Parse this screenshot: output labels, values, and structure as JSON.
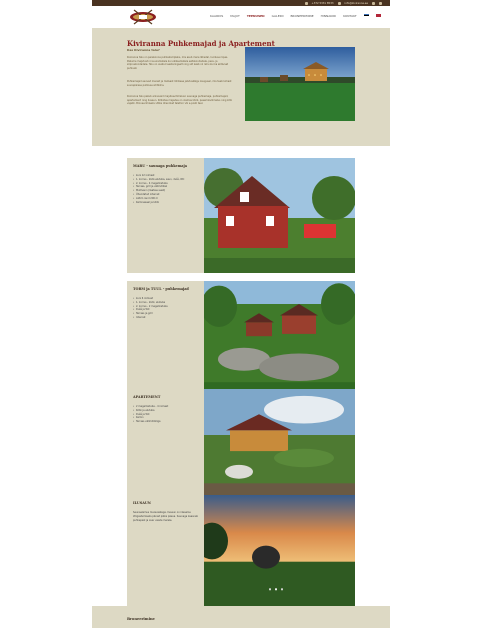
{
  "topbar": {
    "phone": "+372 5331 8533",
    "email": "info@kiviranna.ee"
  },
  "nav": {
    "items": [
      "KAARDIS",
      "MAJUT",
      "TEENUSED",
      "GALERII",
      "BRONEERIMINE",
      "HINNAKIRI",
      "KONTAKT"
    ],
    "active_index": 2
  },
  "hero": {
    "title": "Kiviranna Puhkemajad ja Apartement",
    "subtitle": "Kas Kiviranna talu?",
    "para1": "Kiviranna talu on perekonna puhkekompleks, mis asub mere lähedal, looduse rüpes. Pakume majutust nii suurematele kui väiksematele seltskondadele, pere- ja sõpruskondadele. Talu on avatud aastaringselt ning siit leiab nii rahu kui ka aktiivset puhkust.",
    "para2": "Puhkemajad asuvad merest ja metsast lühikese jalutuskäigu kaugusel, mis teeb kohast suurepärase puhkuse sihtkoha.",
    "para3": "Kiviranna talu pakub erinevaid majutusvõimalusi: saunaga puhkemaja, puhkemajad, apartement ning ilusaun. Kõikides majades on olemas köök, pesemisvõimalus ning kõik vajalik. Broneerimiseks võtke ühendust telefoni või e-posti teel."
  },
  "cards": [
    {
      "title": "MARU - saunaga puhkemaja",
      "items": [
        "kuni 12 inimest",
        "1. korrus - köök-elutuba, saun, dušš, WC",
        "2. korrus - 4 magamistuba",
        "Terrass, grill ja välimööbel",
        "Mullivann (lisatasu eest)",
        "Ühendatud internet",
        "Lähim rand 200 m",
        "Kaminasaal ja köök"
      ]
    },
    {
      "title": "TORM ja TUUL - puhkemajad",
      "items": [
        "kuni 6 inimest",
        "1. korrus - köök, elutuba",
        "2. korrus - 2 magamistuba",
        "Dušš ja WC",
        "Terrass ja grill",
        "Internet"
      ]
    },
    {
      "title": "APARTEMENT",
      "items": [
        "2 magamistuba - 4 inimest",
        "Köök ja elutuba",
        "Dušš ja WC",
        "Kamin",
        "Terrass välimööbliga"
      ]
    },
    {
      "title": "ILUSAUN",
      "paragraph": "Saunaelamus merevaatega. Ilusaun on ideaalne lõõgastumiseks pärast pikka päeva. Saunaga kaasneb puhkepaik ja avar vaade merele."
    }
  ],
  "footer": {
    "title": "Broneerimine"
  },
  "colors": {
    "accent": "#8a1f1f",
    "panel": "#ddd9c4",
    "dark": "#4a3321"
  }
}
